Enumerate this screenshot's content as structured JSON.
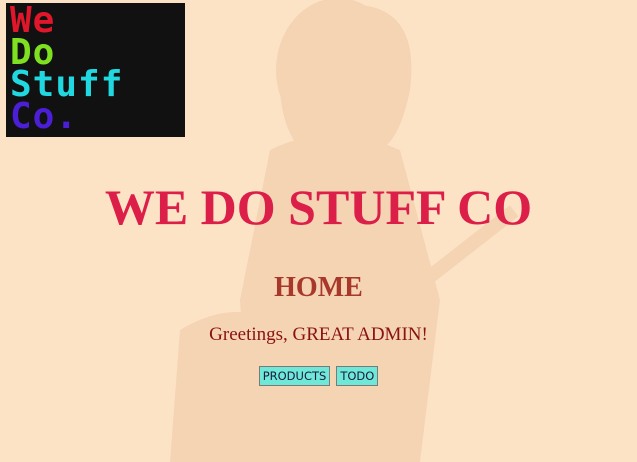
{
  "logo": {
    "lines": [
      "We",
      "Do",
      "Stuff",
      "Co."
    ],
    "colors": [
      "#e0162a",
      "#7ee020",
      "#22d8e0",
      "#4a1fd6"
    ],
    "background": "#111111"
  },
  "site_title": "WE DO STUFF CO",
  "page_heading": "HOME",
  "greeting": "Greetings, GREAT ADMIN!",
  "nav": [
    {
      "label": "PRODUCTS"
    },
    {
      "label": "TODO"
    }
  ],
  "colors": {
    "page_background": "#fde3c6",
    "title": "#dc1f49",
    "heading": "#a8382c",
    "greeting": "#8a1212",
    "button_background": "#6fe8d7"
  }
}
